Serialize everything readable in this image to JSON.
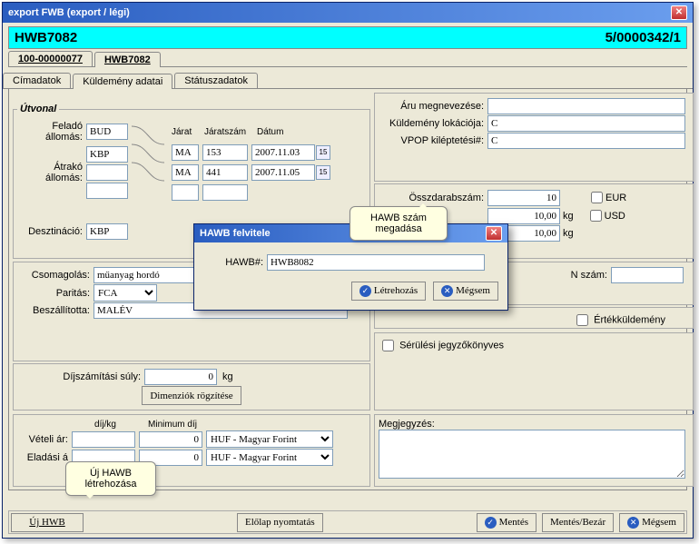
{
  "window": {
    "title": "export FWB (export / légi)"
  },
  "header": {
    "left": "HWB7082",
    "right": "5/0000342/1"
  },
  "outer_tabs": {
    "tab1": "100-00000077",
    "tab2": "HWB7082"
  },
  "inner_tabs": {
    "tab1": "Címadatok",
    "tab2": "Küldemény adatai",
    "tab3": "Státuszadatok"
  },
  "utvonal": {
    "legend": "Útvonal",
    "felado_lbl": "Feladó állomás:",
    "felado_val": "BUD",
    "atrako_lbl": "Átrakó állomás:",
    "atrako1_val": "KBP",
    "atrako2_val": "",
    "hdr_jarat": "Járat",
    "hdr_jaratszam": "Járatszám",
    "hdr_datum": "Dátum",
    "j1_jarat": "MA",
    "j1_szam": "153",
    "j1_datum": "2007.11.03",
    "j2_jarat": "MA",
    "j2_szam": "441",
    "j2_datum": "2007.11.05",
    "j3_jarat": "",
    "j3_szam": "",
    "j3_datum": "",
    "deszt_lbl": "Desztináció:",
    "deszt_val": "KBP"
  },
  "aru": {
    "meg_lbl": "Áru megnevezése:",
    "meg_val": "",
    "lok_lbl": "Küldemény lokációja:",
    "lok_val": "C",
    "vpop_lbl": "VPOP kiléptetési#:",
    "vpop_val": "C"
  },
  "ossz": {
    "dbsz_lbl": "Összdarabszám:",
    "dbsz_val": "10",
    "w1": "10,00",
    "w2": "10,00",
    "kg": "kg",
    "eur_lbl": "EUR",
    "usd_lbl": "USD"
  },
  "nszam": {
    "lbl": "N szám:",
    "val": ""
  },
  "ertek": {
    "lbl": "Értékküldemény"
  },
  "csom": {
    "csom_lbl": "Csomagolás:",
    "csom_val": "műanyag hordó",
    "par_lbl": "Paritás:",
    "par_val": "FCA",
    "besz_lbl": "Beszállította:",
    "besz_val": "MALÉV"
  },
  "dsuly": {
    "lbl": "Díjszámítási súly:",
    "val": "0",
    "unit": "kg",
    "btn": "Dimenziók rögzítése"
  },
  "serul": {
    "lbl": "Sérülési jegyzőkönyves"
  },
  "ar": {
    "hdr_dijkg": "díj/kg",
    "hdr_mindij": "Minimum díj",
    "vetel_lbl": "Vételi ár:",
    "vetel_val": "",
    "eladas_lbl": "Eladási á",
    "zero": "0",
    "currency": "HUF - Magyar Forint"
  },
  "megj": {
    "lbl": "Megjegyzés:"
  },
  "footer": {
    "ujhwb": "Új HWB",
    "elolap": "Előlap nyomtatás",
    "mentes": "Mentés",
    "mentesbezar": "Mentés/Bezár",
    "megsem": "Mégsem"
  },
  "dialog": {
    "title": "HAWB felvitele",
    "field_lbl": "HAWB#:",
    "field_val": "HWB8082",
    "ok": "Létrehozás",
    "cancel": "Mégsem"
  },
  "notes": {
    "hawb_szam": "HAWB szám megadása",
    "uj_hawb": "Új HAWB létrehozása"
  }
}
